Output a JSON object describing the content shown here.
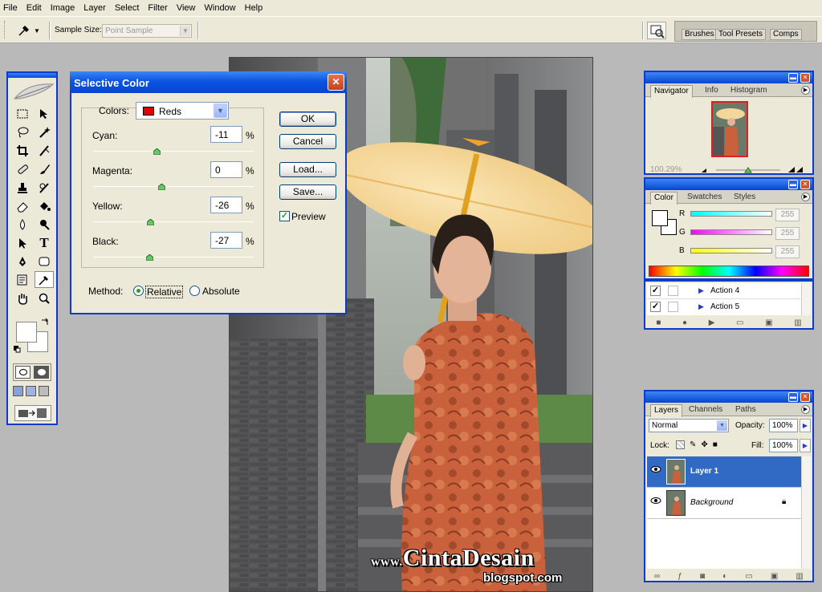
{
  "menu": [
    "File",
    "Edit",
    "Image",
    "Layer",
    "Select",
    "Filter",
    "View",
    "Window",
    "Help"
  ],
  "options": {
    "sample_size_label": "Sample Size:",
    "sample_size_value": "Point Sample",
    "well_tabs": [
      "Brushes",
      "Tool Presets",
      "Comps"
    ]
  },
  "dialog": {
    "title": "Selective Color",
    "colors_label": "Colors:",
    "colors_value": "Reds",
    "sliders": [
      {
        "label": "Cyan:",
        "value": "-11",
        "unit": "%",
        "level": -11
      },
      {
        "label": "Magenta:",
        "value": "0",
        "unit": "%",
        "level": 0
      },
      {
        "label": "Yellow:",
        "value": "-26",
        "unit": "%",
        "level": -26
      },
      {
        "label": "Black:",
        "value": "-27",
        "unit": "%",
        "level": -27
      }
    ],
    "buttons": {
      "ok": "OK",
      "cancel": "Cancel",
      "load": "Load...",
      "save": "Save..."
    },
    "preview_label": "Preview",
    "preview_checked": true,
    "method_label": "Method:",
    "method_options": [
      "Relative",
      "Absolute"
    ],
    "method_selected": "Relative"
  },
  "navigator": {
    "tabs": [
      "Navigator",
      "Info",
      "Histogram"
    ],
    "zoom": "100.29%"
  },
  "color_panel": {
    "tabs": [
      "Color",
      "Swatches",
      "Styles"
    ],
    "channels": [
      {
        "label": "R",
        "value": "255"
      },
      {
        "label": "G",
        "value": "255"
      },
      {
        "label": "B",
        "value": "255"
      }
    ]
  },
  "actions": [
    "Action 4",
    "Action 5"
  ],
  "layers_panel": {
    "tabs": [
      "Layers",
      "Channels",
      "Paths"
    ],
    "blend_mode": "Normal",
    "opacity_label": "Opacity:",
    "opacity_value": "100%",
    "lock_label": "Lock:",
    "fill_label": "Fill:",
    "fill_value": "100%",
    "layers": [
      {
        "name": "Layer 1",
        "selected": true
      },
      {
        "name": "Background",
        "selected": false
      }
    ]
  },
  "watermark": {
    "main": "CintaDesain",
    "prefix": "www.",
    "sub": "blogspot.com"
  },
  "colors": {
    "accent": "#0a3bcc",
    "selection": "#316ac5",
    "dialog_bg": "#ece9d8"
  }
}
